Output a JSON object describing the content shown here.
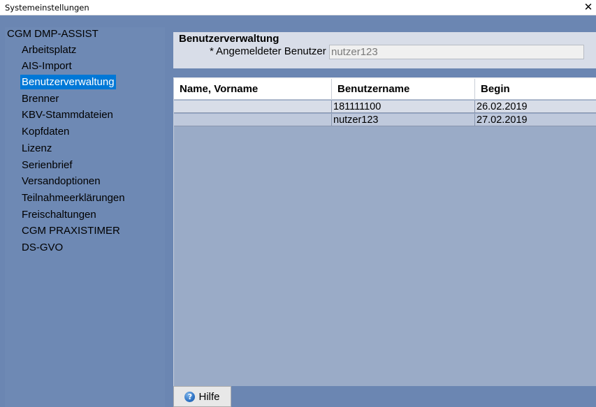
{
  "window": {
    "title": "Systemeinstellungen",
    "close_glyph": "✕"
  },
  "tree": {
    "root": "CGM DMP-ASSIST",
    "items": [
      {
        "label": "Arbeitsplatz",
        "selected": false
      },
      {
        "label": "AIS-Import",
        "selected": false
      },
      {
        "label": "Benutzerverwaltung",
        "selected": true
      },
      {
        "label": "Brenner",
        "selected": false
      },
      {
        "label": "KBV-Stammdateien",
        "selected": false
      },
      {
        "label": "Kopfdaten",
        "selected": false
      },
      {
        "label": "Lizenz",
        "selected": false
      },
      {
        "label": "Serienbrief",
        "selected": false
      },
      {
        "label": "Versandoptionen",
        "selected": false
      },
      {
        "label": "Teilnahmeerklärungen",
        "selected": false
      },
      {
        "label": "Freischaltungen",
        "selected": false
      },
      {
        "label": "CGM PRAXISTIMER",
        "selected": false
      },
      {
        "label": "DS-GVO",
        "selected": false
      }
    ]
  },
  "panel": {
    "title": "Benutzerverwaltung",
    "field_label": "* Angemeldeter Benutzer",
    "field_value": "nutzer123"
  },
  "table": {
    "columns": [
      "Name, Vorname",
      "Benutzername",
      "Begin"
    ],
    "rows": [
      [
        "",
        "181111100",
        "26.02.2019"
      ],
      [
        "",
        "nutzer123",
        "27.02.2019"
      ]
    ]
  },
  "footer": {
    "help_label": "Hilfe"
  },
  "colors": {
    "background": "#6b86b2",
    "selection": "#0078d7",
    "table_body": "#9aabc7"
  }
}
